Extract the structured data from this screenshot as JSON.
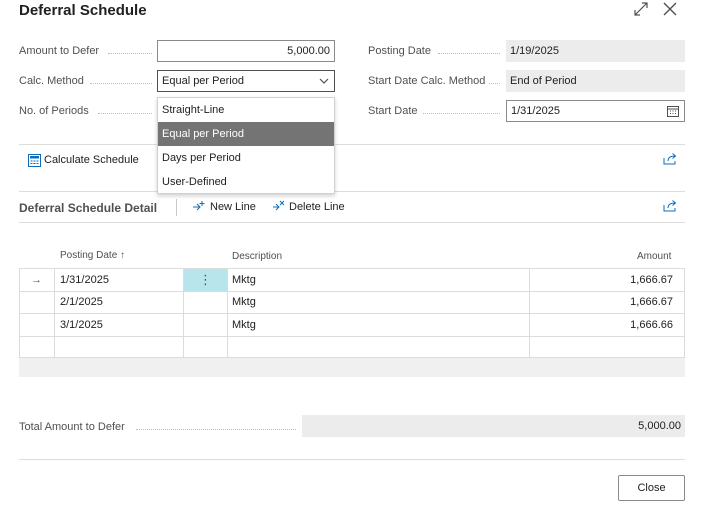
{
  "dialog": {
    "title": "Deferral Schedule",
    "close_label": "Close"
  },
  "fields": {
    "amount_to_defer": {
      "label": "Amount to Defer",
      "value": "5,000.00"
    },
    "calc_method": {
      "label": "Calc. Method",
      "value": "Equal per Period"
    },
    "no_of_periods": {
      "label": "No. of Periods"
    },
    "posting_date": {
      "label": "Posting Date",
      "value": "1/19/2025"
    },
    "start_date_calc_method": {
      "label": "Start Date Calc. Method",
      "value": "End of Period"
    },
    "start_date": {
      "label": "Start Date",
      "value": "1/31/2025"
    }
  },
  "dropdown": {
    "options": [
      "Straight-Line",
      "Equal per Period",
      "Days per Period",
      "User-Defined"
    ],
    "selected": "Equal per Period"
  },
  "actions": {
    "calculate_schedule": "Calculate Schedule"
  },
  "detail": {
    "title": "Deferral Schedule Detail",
    "new_line": "New Line",
    "delete_line": "Delete Line",
    "columns": {
      "posting_date": "Posting Date",
      "sort_indicator": "↑",
      "description": "Description",
      "amount": "Amount"
    },
    "rows": [
      {
        "posting_date": "1/31/2025",
        "description": "Mktg",
        "amount": "1,666.67"
      },
      {
        "posting_date": "2/1/2025",
        "description": "Mktg",
        "amount": "1,666.67"
      },
      {
        "posting_date": "3/1/2025",
        "description": "Mktg",
        "amount": "1,666.66"
      }
    ],
    "current_row_marker": "→",
    "row_menu_glyph": "⋮"
  },
  "total": {
    "label": "Total Amount to Defer",
    "value": "5,000.00"
  },
  "icons": {
    "expand": "expand-icon",
    "close": "close-icon",
    "chevron": "chevron-down-icon",
    "calendar": "calendar-icon",
    "share": "share-icon",
    "calculate": "calculate-icon",
    "new_line": "new-line-icon",
    "delete_line": "delete-line-icon"
  },
  "colors": {
    "selected_option": "#747474",
    "active_cell": "#b8e4ec",
    "readonly_bg": "#ececec",
    "accent": "#0f6cbd"
  }
}
